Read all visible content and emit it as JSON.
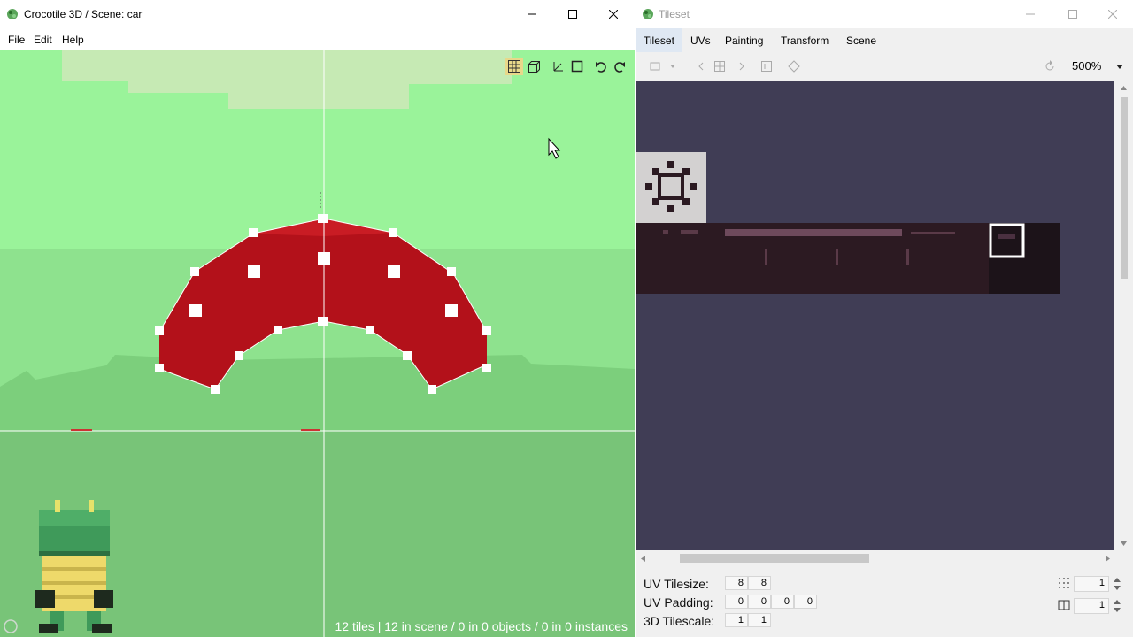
{
  "left_window": {
    "title": "Crocotile 3D / Scene: car",
    "menu": [
      "File",
      "Edit",
      "Help"
    ],
    "status_text": "12 tiles | 12 in scene / 0 in 0 objects / 0 in 0 instances",
    "tool_icons": [
      "grid-icon",
      "camera-cube-icon",
      "move-gizmo-icon",
      "square-icon",
      "undo-icon",
      "redo-icon"
    ]
  },
  "right_window": {
    "title": "Tileset",
    "tabs": [
      "Tileset",
      "UVs",
      "Painting",
      "Transform",
      "Scene"
    ],
    "zoom": "500%",
    "uv_tilesize_label": "UV Tilesize:",
    "uv_tilesize": [
      "8",
      "8"
    ],
    "uv_padding_label": "UV Padding:",
    "uv_padding": [
      "0",
      "0",
      "0",
      "0"
    ],
    "tilescale_label": "3D Tilescale:",
    "tilescale": [
      "1",
      "1"
    ],
    "spinner_values": [
      "1",
      "1"
    ]
  },
  "colors": {
    "sky_green": "#9af39a",
    "ground_green": "#78c478",
    "car_red": "#b3111a",
    "tileset_bg": "#403d55"
  }
}
